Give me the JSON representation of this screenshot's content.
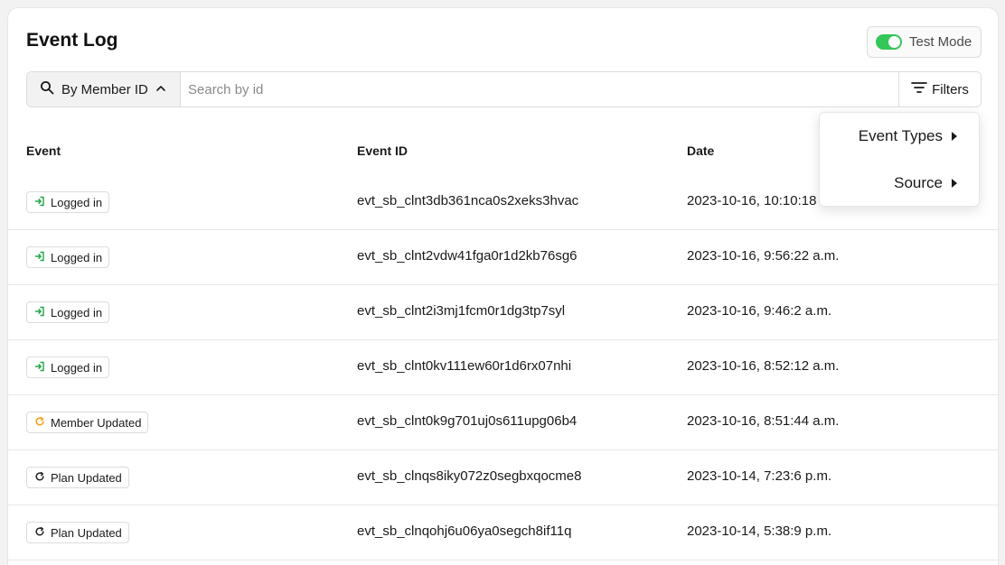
{
  "header": {
    "title": "Event Log",
    "test_mode_label": "Test Mode",
    "test_mode_on": true
  },
  "search": {
    "mode_label": "By Member ID",
    "placeholder": "Search by id",
    "value": "",
    "filters_label": "Filters"
  },
  "table": {
    "columns": [
      "Event",
      "Event ID",
      "Date"
    ],
    "rows": [
      {
        "event": "Logged in",
        "icon": "login-icon",
        "event_id": "evt_sb_clnt3db361nca0s2xeks3hvac",
        "date": "2023-10-16, 10:10:18 a.m."
      },
      {
        "event": "Logged in",
        "icon": "login-icon",
        "event_id": "evt_sb_clnt2vdw41fga0r1d2kb76sg6",
        "date": "2023-10-16, 9:56:22 a.m."
      },
      {
        "event": "Logged in",
        "icon": "login-icon",
        "event_id": "evt_sb_clnt2i3mj1fcm0r1dg3tp7syl",
        "date": "2023-10-16, 9:46:2 a.m."
      },
      {
        "event": "Logged in",
        "icon": "login-icon",
        "event_id": "evt_sb_clnt0kv111ew60r1d6rx07nhi",
        "date": "2023-10-16, 8:52:12 a.m."
      },
      {
        "event": "Member Updated",
        "icon": "refresh-icon",
        "event_id": "evt_sb_clnt0k9g701uj0s611upg06b4",
        "date": "2023-10-16, 8:51:44 a.m."
      },
      {
        "event": "Plan Updated",
        "icon": "refresh-icon",
        "event_id": "evt_sb_clnqs8iky072z0segbxqocme8",
        "date": "2023-10-14, 7:23:6 p.m."
      },
      {
        "event": "Plan Updated",
        "icon": "refresh-icon",
        "event_id": "evt_sb_clnqohj6u06ya0segch8if11q",
        "date": "2023-10-14, 5:38:9 p.m."
      }
    ]
  },
  "filters_menu": {
    "items": [
      "Event Types",
      "Source"
    ]
  },
  "colors": {
    "toggle_on": "#34c759",
    "login_icon": "#22a447",
    "member_updated_icon": "#f59e0b",
    "plan_updated_icon": "#222222"
  }
}
